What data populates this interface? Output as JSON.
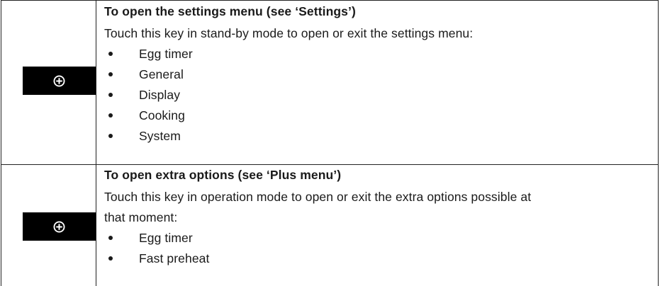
{
  "rows": [
    {
      "heading": "To open the settings menu (see ‘Settings’)",
      "description": "Touch this key in stand-by mode to open or exit the settings menu:",
      "icon": "plus-circle-icon",
      "bullets": [
        "Egg timer",
        "General",
        "Display",
        "Cooking",
        "System"
      ]
    },
    {
      "heading": "To open extra options (see ‘Plus menu’)",
      "description_line1": "Touch this key in operation mode to open or exit the extra options possible at",
      "description_line2": "that moment:",
      "icon": "plus-circle-icon",
      "bullets": [
        "Egg timer",
        "Fast preheat"
      ]
    }
  ]
}
